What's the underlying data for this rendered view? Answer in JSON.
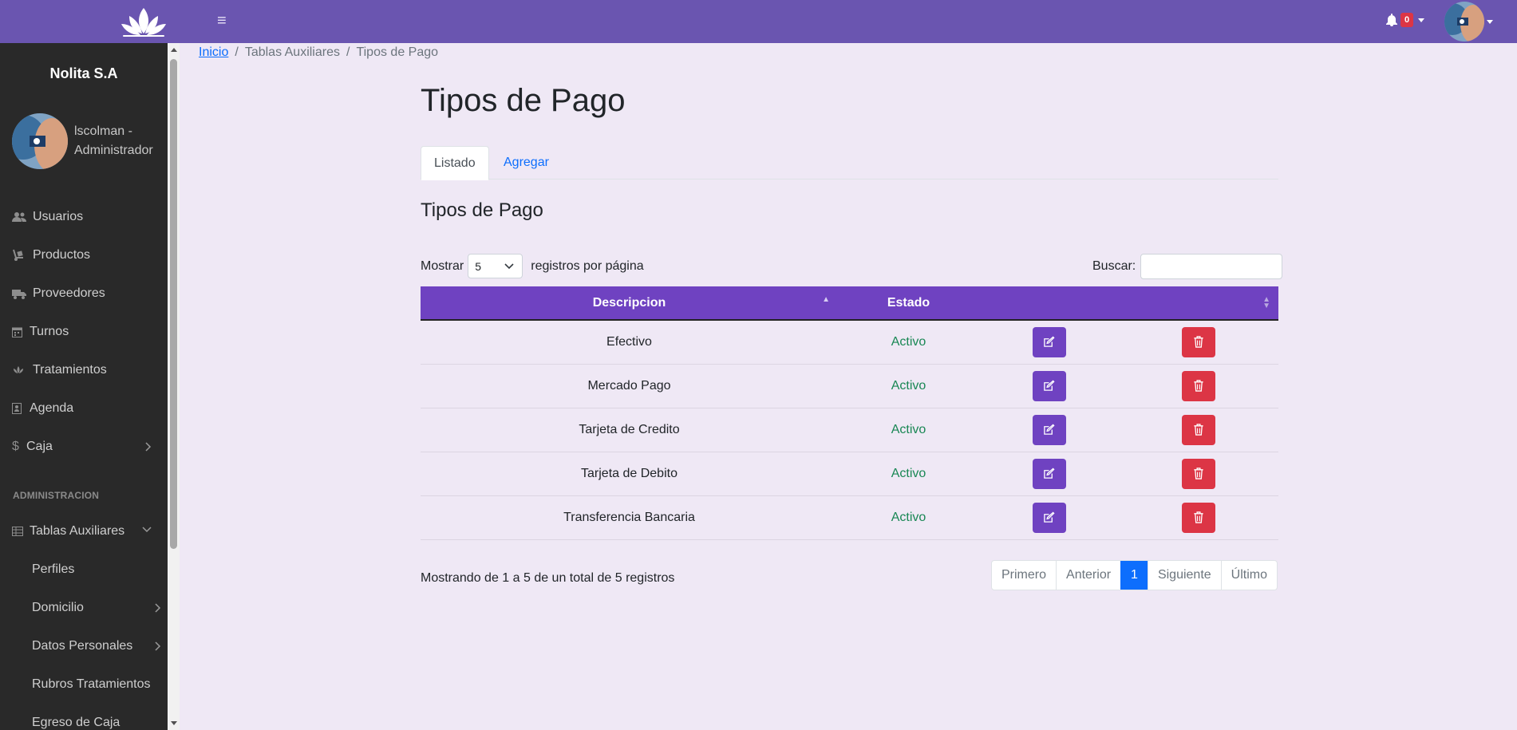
{
  "topbar": {
    "notification_count": "0",
    "brand_color": "#6a55b0"
  },
  "sidebar": {
    "brand": "Nolita S.A",
    "user_name": "lscolman - Administrador",
    "items": [
      {
        "label": "Usuarios",
        "icon": "users-icon"
      },
      {
        "label": "Productos",
        "icon": "dolly-icon"
      },
      {
        "label": "Proveedores",
        "icon": "truck-icon"
      },
      {
        "label": "Turnos",
        "icon": "calendar-icon"
      },
      {
        "label": "Tratamientos",
        "icon": "lotus-icon"
      },
      {
        "label": "Agenda",
        "icon": "address-book-icon"
      },
      {
        "label": "Caja",
        "icon": "dollar-icon"
      }
    ],
    "section_heading": "ADMINISTRACION",
    "group": {
      "label": "Tablas Auxiliares",
      "icon": "table-icon"
    },
    "sub_items": [
      {
        "label": "Perfiles"
      },
      {
        "label": "Domicilio"
      },
      {
        "label": "Datos Personales"
      },
      {
        "label": "Rubros Tratamientos"
      },
      {
        "label": "Egreso de Caja"
      }
    ]
  },
  "breadcrumb": {
    "home": "Inicio",
    "sep": "/",
    "section": "Tablas Auxiliares",
    "current": "Tipos de Pago"
  },
  "main": {
    "title": "Tipos de Pago",
    "tabs": [
      {
        "label": "Listado"
      },
      {
        "label": "Agregar"
      }
    ],
    "table_title": "Tipos de Pago",
    "length_label_before": "Mostrar",
    "length_value": "5",
    "length_label_after": "registros por página",
    "search_label": "Buscar:",
    "search_value": "",
    "columns": [
      "Descripcion",
      "Estado"
    ],
    "rows": [
      {
        "descripcion": "Efectivo",
        "estado": "Activo"
      },
      {
        "descripcion": "Mercado Pago",
        "estado": "Activo"
      },
      {
        "descripcion": "Tarjeta de Credito",
        "estado": "Activo"
      },
      {
        "descripcion": "Tarjeta de Debito",
        "estado": "Activo"
      },
      {
        "descripcion": "Transferencia Bancaria",
        "estado": "Activo"
      }
    ],
    "info": "Mostrando de 1 a 5 de un total de 5 registros",
    "pagination": [
      "Primero",
      "Anterior",
      "1",
      "Siguiente",
      "Último"
    ]
  }
}
